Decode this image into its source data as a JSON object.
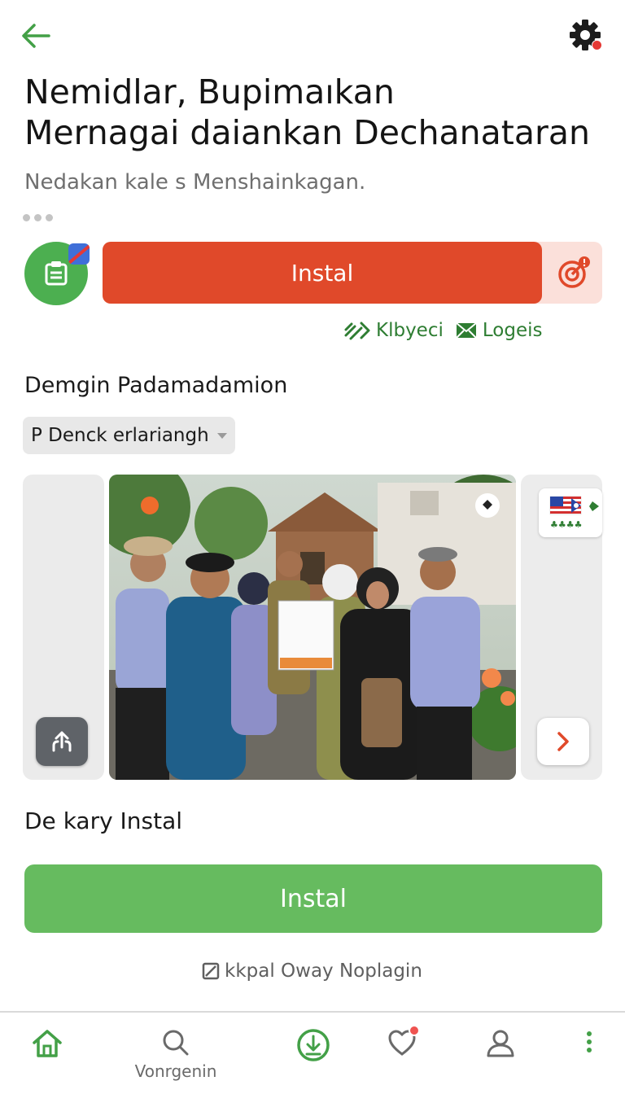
{
  "header": {
    "title_line1": "Nemidlar, Bupimaıkan",
    "title_line2": "Mernagai daiankan Dechanataran",
    "subtitle": "Nedakan kale s Menshainkagan."
  },
  "install": {
    "primary_label": "Instal"
  },
  "links": {
    "first": "Klbyeci",
    "second": "Logeis"
  },
  "section": {
    "title": "Demgin Padamadamion",
    "dropdown_value": "P Denck erlariangh"
  },
  "footer_section": {
    "title": "De kary Instal",
    "install_label": "Instal",
    "plugin_note": "kkpal Oway Noplagin"
  },
  "bottom_nav": {
    "search_label": "Vonrgenin"
  },
  "colors": {
    "accent_green": "#4caf50",
    "install_red": "#e0492a",
    "install_green": "#66bb5f"
  },
  "icons": {
    "back": "arrow-left-icon",
    "settings": "gear-icon",
    "app": "clipboard-icon",
    "target": "target-icon",
    "share": "share-icon",
    "next": "chevron-right-icon"
  }
}
